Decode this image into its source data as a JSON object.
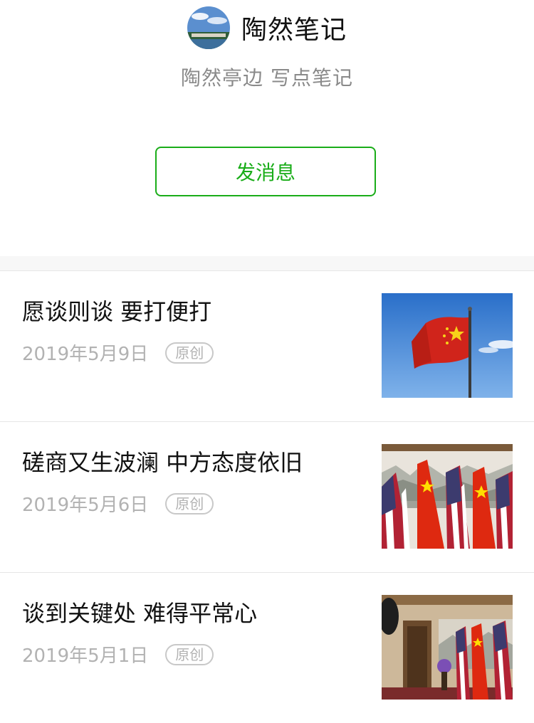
{
  "account": {
    "name": "陶然笔记",
    "description": "陶然亭边 写点笔记",
    "send_message_label": "发消息"
  },
  "articles": [
    {
      "title": "愿谈则谈 要打便打",
      "date": "2019年5月9日",
      "tag": "原创",
      "thumbnail": "flag-on-pole-image"
    },
    {
      "title": "磋商又生波澜 中方态度依旧",
      "date": "2019年5月6日",
      "tag": "原创",
      "thumbnail": "flags-row-image"
    },
    {
      "title": "谈到关键处 难得平常心",
      "date": "2019年5月1日",
      "tag": "原创",
      "thumbnail": "meeting-room-flags-image"
    }
  ],
  "colors": {
    "accent": "#1aad19",
    "text": "#111111",
    "meta": "#b2b2b2",
    "divider": "#e6e6e6"
  }
}
